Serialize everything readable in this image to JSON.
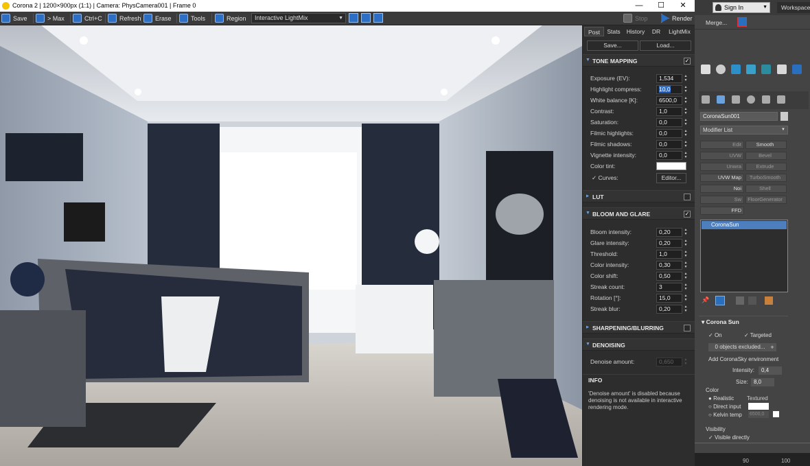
{
  "window": {
    "title": "Corona 2 | 1200×900px (1:1) | Camera: PhysCamera001 | Frame 0"
  },
  "toolbar": {
    "save": "Save",
    "max": "> Max",
    "ctrlc": "Ctrl+C",
    "refresh": "Refresh",
    "erase": "Erase",
    "tools": "Tools",
    "region": "Region",
    "lightmix_select": "Interactive LightMix",
    "stop": "Stop",
    "render": "Render"
  },
  "panel": {
    "tabs": [
      "Post",
      "Stats",
      "History",
      "DR",
      "LightMix"
    ],
    "save_btn": "Save...",
    "load_btn": "Load...",
    "tone_mapping": {
      "title": "TONE MAPPING",
      "rows": [
        {
          "label": "Exposure (EV):",
          "value": "1,534"
        },
        {
          "label": "Highlight compress:",
          "value": "10,0"
        },
        {
          "label": "White balance [K]:",
          "value": "6500,0"
        },
        {
          "label": "Contrast:",
          "value": "1,0"
        },
        {
          "label": "Saturation:",
          "value": "0,0"
        },
        {
          "label": "Filmic highlights:",
          "value": "0,0"
        },
        {
          "label": "Filmic shadows:",
          "value": "0,0"
        },
        {
          "label": "Vignette intensity:",
          "value": "0,0"
        }
      ],
      "color_tint_label": "Color tint:",
      "curves_label": "Curves:",
      "editor_btn": "Editor..."
    },
    "lut": {
      "title": "LUT"
    },
    "bloom": {
      "title": "BLOOM AND GLARE",
      "rows": [
        {
          "label": "Bloom intensity:",
          "value": "0,20"
        },
        {
          "label": "Glare intensity:",
          "value": "0,20"
        },
        {
          "label": "Threshold:",
          "value": "1,0"
        },
        {
          "label": "Color intensity:",
          "value": "0,30"
        },
        {
          "label": "Color shift:",
          "value": "0,50"
        },
        {
          "label": "Streak count:",
          "value": "3"
        },
        {
          "label": "Rotation [°]:",
          "value": "15,0"
        },
        {
          "label": "Streak blur:",
          "value": "0,20"
        }
      ]
    },
    "sharpening": {
      "title": "SHARPENING/BLURRING"
    },
    "denoising": {
      "title": "DENOISING",
      "label": "Denoise amount:",
      "value": "0,650"
    },
    "info": {
      "title": "INFO",
      "text": "'Denoise amount' is disabled because denoising is not available in interactive rendering mode."
    }
  },
  "max": {
    "signin": "Sign In",
    "workspaces": "Workspaces",
    "merge": "Merge...",
    "object_name": "CoronaSun001",
    "modifier_list": "Modifier List",
    "modifiers": [
      [
        "Edit",
        "Smooth"
      ],
      [
        "UVW",
        "Bevel"
      ],
      [
        "Unwra",
        "Extrude"
      ],
      [
        "UVW Map",
        "TurboSmooth"
      ],
      [
        "Noi",
        "Shell"
      ],
      [
        "Sw",
        "FloorGenerator"
      ],
      [
        "FFD",
        ""
      ]
    ],
    "stack_item": "CoronaSun",
    "rollout_title": "Corona Sun",
    "on": "On",
    "targeted": "Targeted",
    "excluded": "0 objects excluded...",
    "add_sky": "Add CoronaSky environment",
    "intensity_label": "Intensity:",
    "intensity": "0,4",
    "size_label": "Size:",
    "size": "8,0",
    "color_group": "Color",
    "realistic": "Realistic",
    "textured": "Textured",
    "direct_input": "Direct input",
    "kelvin": "Kelvin temp",
    "kelvin_val": "6500,0",
    "visibility": "Visibility",
    "visible_directly": "Visible directly",
    "ruler": [
      "90",
      "100"
    ]
  }
}
